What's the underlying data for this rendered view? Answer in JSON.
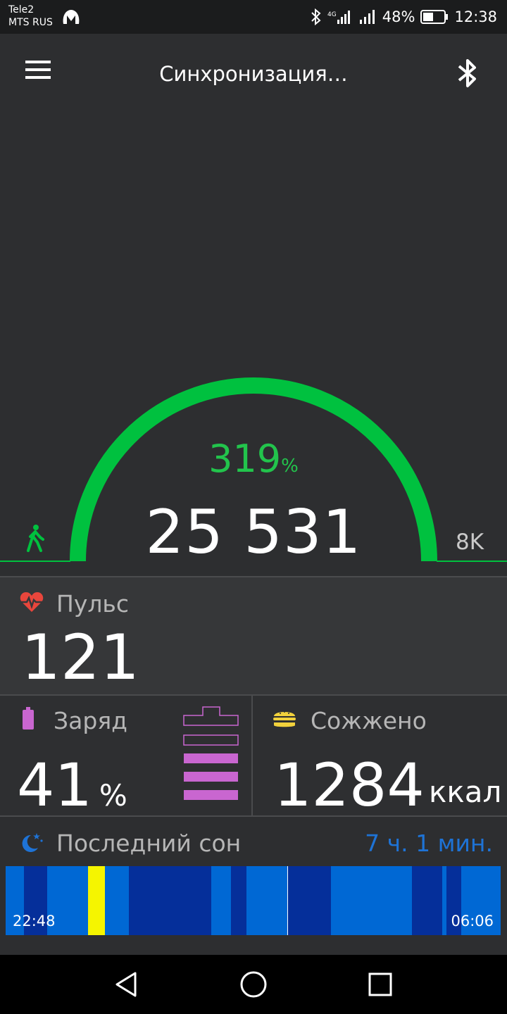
{
  "status_bar": {
    "carrier_1": "Tele2",
    "carrier_2": "MTS RUS",
    "battery_percent": "48%",
    "time": "12:38",
    "network_type": "4G"
  },
  "header": {
    "title": "Синхронизация…",
    "menu_icon": "hamburger-menu-icon",
    "bluetooth_icon": "bluetooth-icon"
  },
  "steps": {
    "percent_value": "319",
    "percent_symbol": "%",
    "count": "25 531",
    "goal": "8K",
    "progress_fraction": 1.0,
    "color": "#00c13f"
  },
  "pulse": {
    "label": "Пульс",
    "value": "121",
    "icon": "heart-rate-icon",
    "icon_color": "#e9463c"
  },
  "charge": {
    "label": "Заряд",
    "value": "41",
    "unit": "%",
    "level_fraction": 0.41,
    "color": "#c966d0"
  },
  "burned": {
    "label": "Сожжено",
    "value": "1284",
    "unit": "ккал",
    "icon": "burger-icon",
    "icon_color": "#f2d23c"
  },
  "sleep": {
    "label": "Последний сон",
    "duration": "7 ч. 1 мин.",
    "duration_color": "#1e73d6",
    "start_time": "22:48",
    "end_time": "06:06",
    "phase_colors": {
      "light": "#0068d4",
      "deep": "#052f9a",
      "awake": "#f5f500"
    }
  },
  "nav_bar": {
    "back_icon": "back-triangle-icon",
    "home_icon": "home-circle-icon",
    "recents_icon": "recents-square-icon"
  }
}
